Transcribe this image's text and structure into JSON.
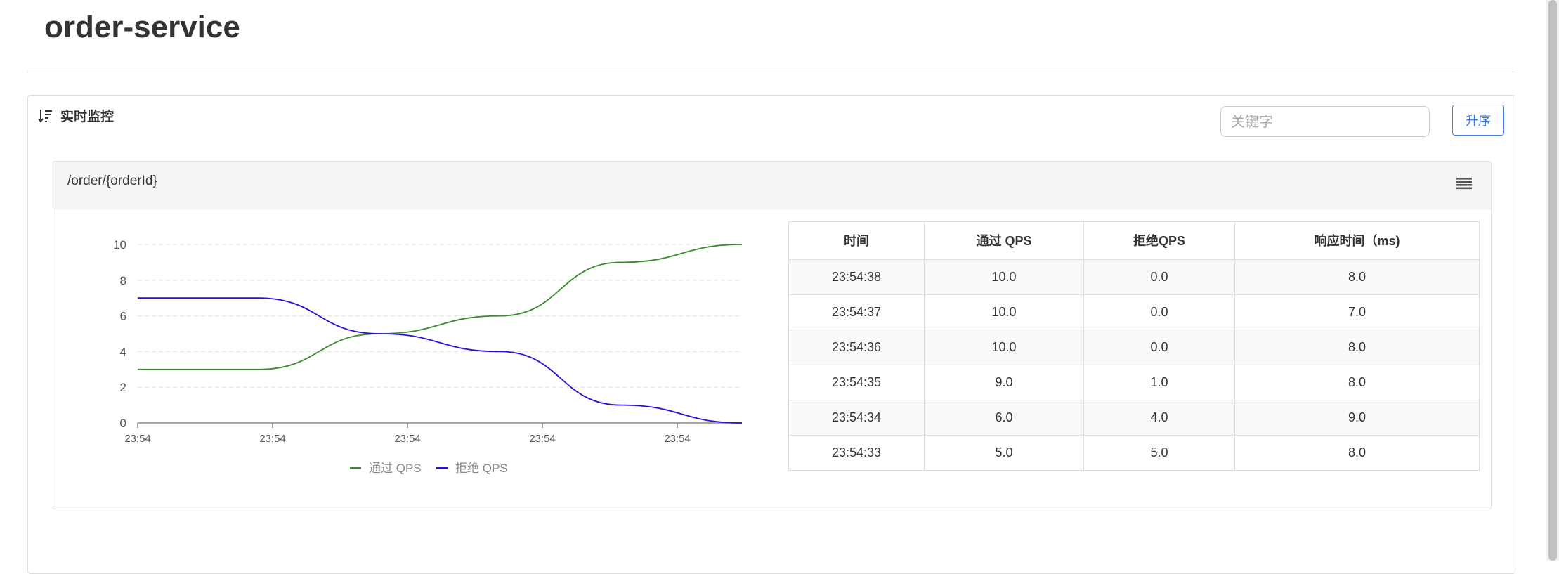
{
  "page": {
    "title": "order-service"
  },
  "panel": {
    "title": "实时监控",
    "search_placeholder": "关键字",
    "sort_label": "升序"
  },
  "resource_card": {
    "name": "/order/{orderId}",
    "menu_icon": "hamburger-menu-icon"
  },
  "chart_data": {
    "type": "line",
    "x": [
      "23:54:33",
      "23:54:34",
      "23:54:35",
      "23:54:36",
      "23:54:37",
      "23:54:38"
    ],
    "tick_labels": [
      "23:54",
      "23:54",
      "23:54",
      "23:54",
      "23:54"
    ],
    "series": [
      {
        "name": "通过 QPS",
        "color": "#3a8a2e",
        "values": [
          3,
          3,
          5,
          6,
          9,
          10
        ]
      },
      {
        "name": "拒绝 QPS",
        "color": "#2b10d6",
        "values": [
          7,
          7,
          5,
          4,
          1,
          0
        ]
      }
    ],
    "ylim": [
      0,
      10
    ],
    "yticks": [
      0,
      2,
      4,
      6,
      8,
      10
    ],
    "grid": true,
    "legend": "bottom-center",
    "smooth": true
  },
  "table": {
    "headers": [
      "时间",
      "通过 QPS",
      "拒绝QPS",
      "响应时间（ms)"
    ],
    "rows": [
      [
        "23:54:38",
        "10.0",
        "0.0",
        "8.0"
      ],
      [
        "23:54:37",
        "10.0",
        "0.0",
        "7.0"
      ],
      [
        "23:54:36",
        "10.0",
        "0.0",
        "8.0"
      ],
      [
        "23:54:35",
        "9.0",
        "1.0",
        "8.0"
      ],
      [
        "23:54:34",
        "6.0",
        "4.0",
        "9.0"
      ],
      [
        "23:54:33",
        "5.0",
        "5.0",
        "8.0"
      ]
    ]
  },
  "colors": {
    "accent": "#3c7bea",
    "pass_series": "#3a8a2e",
    "block_series": "#2b10d6"
  }
}
